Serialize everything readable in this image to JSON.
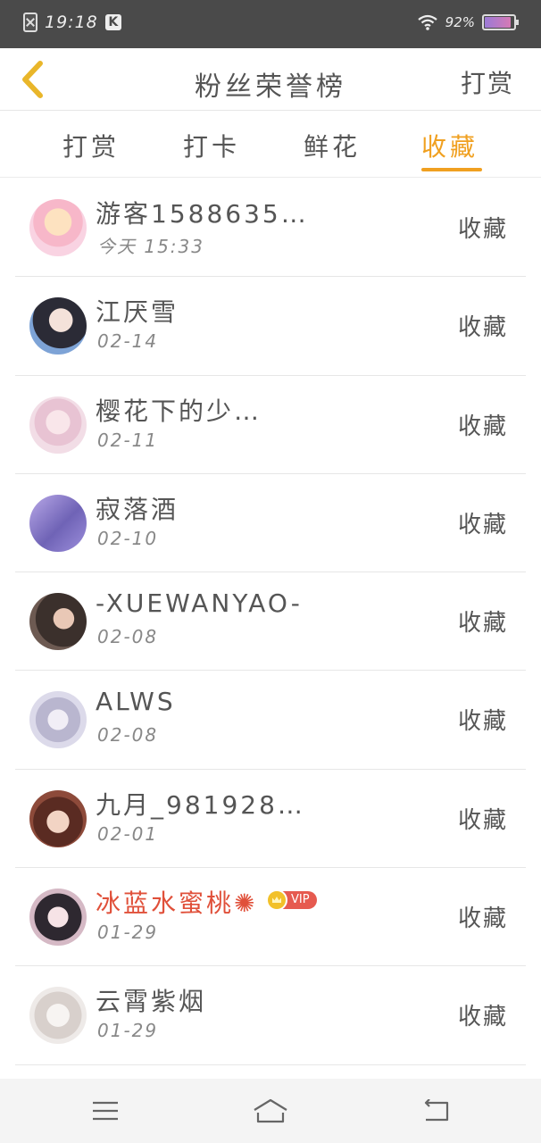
{
  "status_bar": {
    "time": "19:18",
    "k_badge": "K",
    "battery": "92%",
    "battery_level": 0.92
  },
  "header": {
    "title": "粉丝荣誉榜",
    "action": "打赏"
  },
  "tabs": [
    {
      "label": "打赏",
      "active": false
    },
    {
      "label": "打卡",
      "active": false
    },
    {
      "label": "鲜花",
      "active": false
    },
    {
      "label": "收藏",
      "active": true
    }
  ],
  "fans": [
    {
      "name": "游客1588635…",
      "date": "今天 15:33",
      "action": "收藏",
      "vip": false
    },
    {
      "name": "江厌雪",
      "date": "02-14",
      "action": "收藏",
      "vip": false
    },
    {
      "name": "樱花下的少…",
      "date": "02-11",
      "action": "收藏",
      "vip": false
    },
    {
      "name": "寂落酒",
      "date": "02-10",
      "action": "收藏",
      "vip": false
    },
    {
      "name": "-XUEWANYAO-",
      "date": "02-08",
      "action": "收藏",
      "vip": false
    },
    {
      "name": "ALWS",
      "date": "02-08",
      "action": "收藏",
      "vip": false
    },
    {
      "name": "九月_981928…",
      "date": "02-01",
      "action": "收藏",
      "vip": false
    },
    {
      "name": "冰蓝水蜜桃✺",
      "date": "01-29",
      "action": "收藏",
      "vip": true,
      "vip_label": "VIP"
    },
    {
      "name": "云霄紫烟",
      "date": "01-29",
      "action": "收藏",
      "vip": false
    }
  ],
  "colors": {
    "accent": "#f0a020",
    "vip_name": "#e0503a",
    "vip_badge": "#e65a4f"
  }
}
